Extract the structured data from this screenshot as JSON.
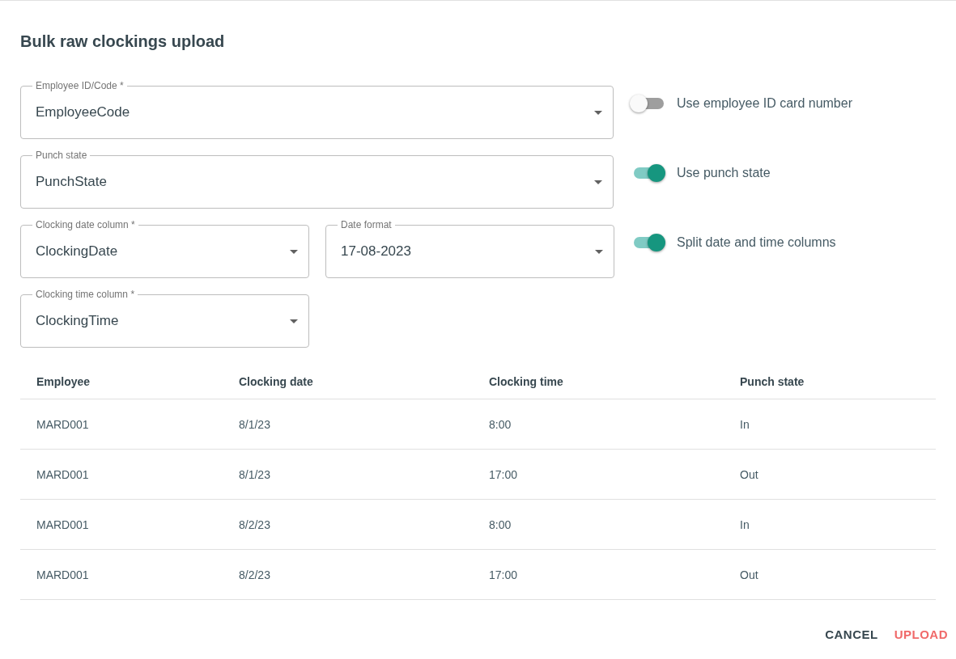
{
  "dialog": {
    "title": "Bulk raw clockings upload"
  },
  "form_rows": [
    {
      "fields": [
        {
          "label": "Employee ID/Code *",
          "value": "EmployeeCode"
        }
      ],
      "toggle": {
        "label": "Use employee ID card number",
        "on": false
      }
    },
    {
      "fields": [
        {
          "label": "Punch state",
          "value": "PunchState"
        }
      ],
      "toggle": {
        "label": "Use punch state",
        "on": true
      }
    },
    {
      "fields": [
        {
          "label": "Clocking date column *",
          "value": "ClockingDate"
        },
        {
          "label": "Date format",
          "value": "17-08-2023"
        }
      ],
      "toggle": {
        "label": "Split date and time columns",
        "on": true
      }
    },
    {
      "fields": [
        {
          "label": "Clocking time column *",
          "value": "ClockingTime"
        }
      ]
    }
  ],
  "table": {
    "columns": [
      "Employee",
      "Clocking date",
      "Clocking time",
      "Punch state"
    ],
    "rows": [
      [
        "MARD001",
        "8/1/23",
        "8:00",
        "In"
      ],
      [
        "MARD001",
        "8/1/23",
        "17:00",
        "Out"
      ],
      [
        "MARD001",
        "8/2/23",
        "8:00",
        "In"
      ],
      [
        "MARD001",
        "8/2/23",
        "17:00",
        "Out"
      ]
    ]
  },
  "buttons": [
    {
      "label": "CANCEL",
      "kind": "neutral"
    },
    {
      "label": "UPLOAD",
      "kind": "primary"
    }
  ]
}
